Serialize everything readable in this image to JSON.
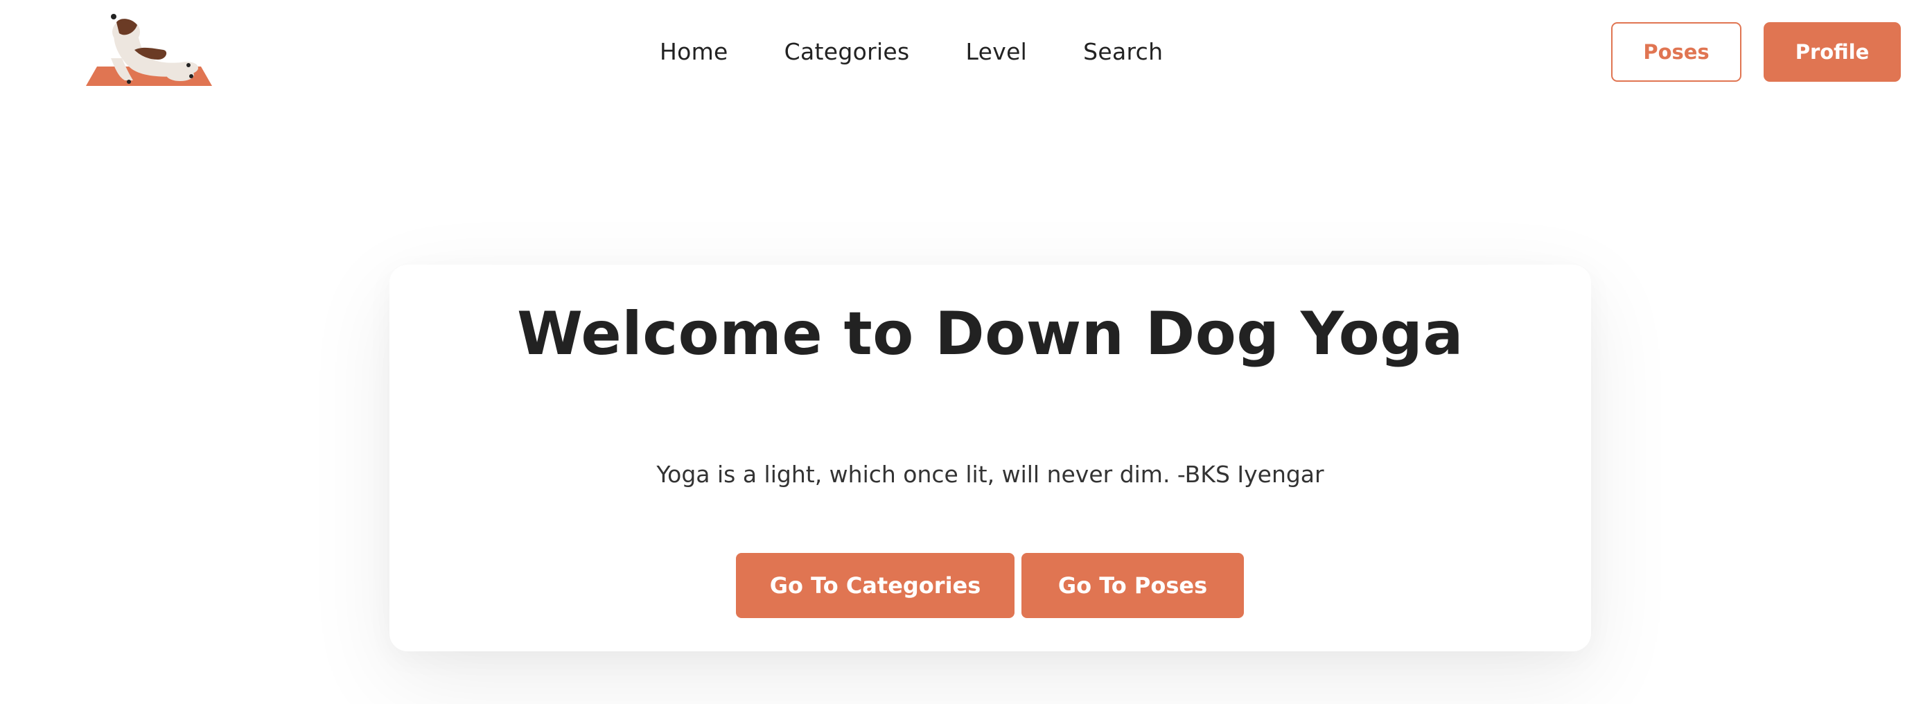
{
  "brand": {
    "logo": "dog-on-yoga-mat-logo",
    "accent_color": "#e07552",
    "text_color": "#222222"
  },
  "nav": {
    "items": [
      {
        "label": "Home"
      },
      {
        "label": "Categories"
      },
      {
        "label": "Level"
      },
      {
        "label": "Search"
      }
    ]
  },
  "header_actions": {
    "poses_label": "Poses",
    "profile_label": "Profile"
  },
  "hero": {
    "title": "Welcome to Down Dog Yoga",
    "quote": "Yoga is a light, which once lit, will never dim. -BKS Iyengar",
    "buttons": {
      "categories_label": "Go To Categories",
      "poses_label": "Go To Poses"
    }
  }
}
